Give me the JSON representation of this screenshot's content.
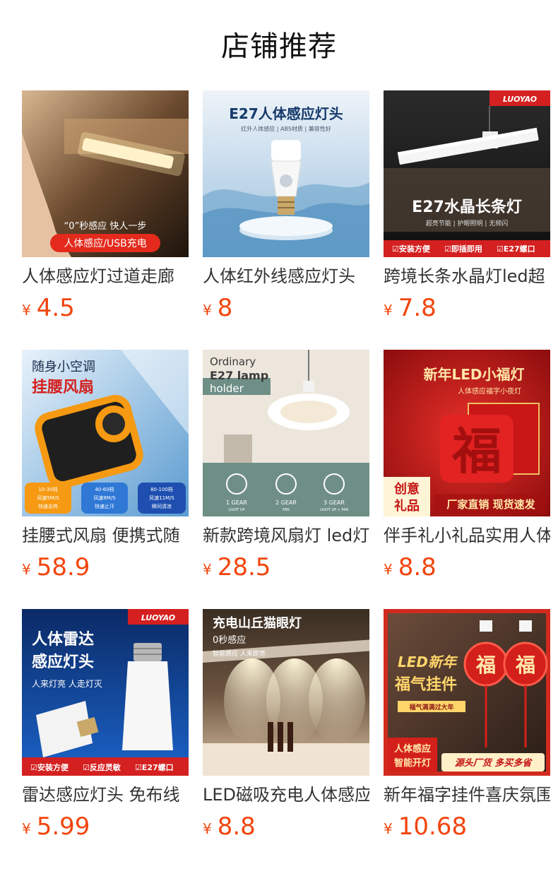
{
  "header": {
    "title": "店铺推荐"
  },
  "currency_symbol": "¥",
  "colors": {
    "price": "#f2450e"
  },
  "products": [
    {
      "name": "人体感应灯过道走廊",
      "price": "4.5",
      "image_text": [
        "“0”秒感应 快人一步",
        "人体感应/USB充电"
      ]
    },
    {
      "name": "人体红外线感应灯头",
      "price": "8",
      "image_text": [
        "E27人体感应灯头",
        "红外人体感应 | ABS材质 | 兼容性好"
      ]
    },
    {
      "name": "跨境长条水晶灯led超",
      "price": "7.8",
      "image_text": [
        "LUOYAO",
        "E27水晶长条灯",
        "超亮节能 | 护眼照明 | 无频闪",
        "☑安装方便",
        "☑即插即用",
        "☑E27螺口"
      ]
    },
    {
      "name": "挂腰式风扇 便携式随",
      "price": "58.9",
      "image_text": [
        "随身小空调",
        "挂腰风扇",
        "10-30档",
        "风速5M/S",
        "快速去热",
        "40-60档",
        "风速8M/S",
        "快速止汗",
        "80-100档",
        "风速11M/S",
        "瞬间清凉"
      ]
    },
    {
      "name": "新款跨境风扇灯 led灯",
      "price": "28.5",
      "image_text": [
        "Ordinary",
        "E27 lamp",
        "holder",
        "1 GEAR",
        "LIGHT UP",
        "2 GEAR",
        "FAN",
        "3 GEAR",
        "LIGHT UP + FAN"
      ]
    },
    {
      "name": "伴手礼小礼品实用人体",
      "price": "8.8",
      "image_text": [
        "新年LED小福灯",
        "人体感应福字小夜灯",
        "福",
        "创意",
        "礼品",
        "厂家直销 现货速发"
      ]
    },
    {
      "name": "雷达感应灯头 免布线",
      "price": "5.99",
      "image_text": [
        "LUOYAO",
        "人体雷达",
        "感应灯头",
        "人来灯亮 人走灯灭",
        "☑安装方便",
        "☑反应灵敏",
        "☑E27螺口"
      ]
    },
    {
      "name": "LED磁吸充电人体感应",
      "price": "8.8",
      "image_text": [
        "充电山丘猫眼灯",
        "0秒感应",
        "智能感应 人来即亮"
      ]
    },
    {
      "name": "新年福字挂件喜庆氛围",
      "price": "10.68",
      "image_text": [
        "LED新年",
        "福气挂件",
        "福气满满过大年",
        "福",
        "人体感应",
        "智能开灯",
        "源头厂货 多买多省"
      ]
    }
  ]
}
